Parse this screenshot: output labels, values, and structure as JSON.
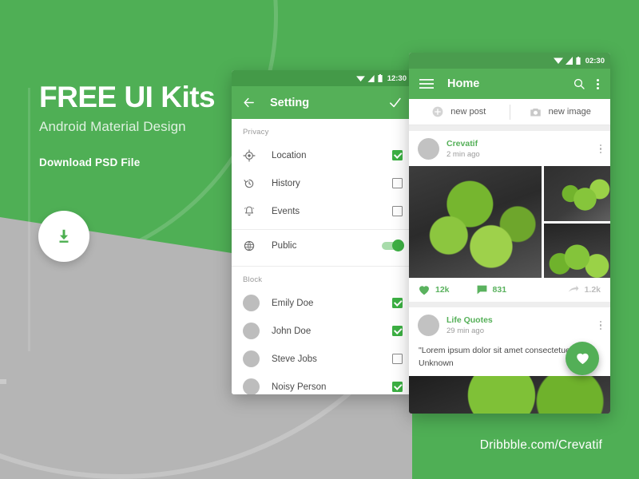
{
  "promo": {
    "title": "FREE UI Kits",
    "subtitle": "Android Material Design",
    "cta": "Download PSD File",
    "download_icon": "download-icon",
    "footer_url": "Dribbble.com/Crevatif",
    "accent_green": "#55b058",
    "background_gray": "#b5b5b5"
  },
  "settings_phone": {
    "status_bar": {
      "time": "12:30",
      "icons": [
        "wifi-icon",
        "signal-icon",
        "battery-icon"
      ]
    },
    "appbar": {
      "back_icon": "back-arrow-icon",
      "title": "Setting",
      "confirm_icon": "check-icon"
    },
    "sections": [
      {
        "label": "Privacy",
        "rows": [
          {
            "icon": "location-icon",
            "label": "Location",
            "control": "checkbox",
            "checked": true
          },
          {
            "icon": "history-icon",
            "label": "History",
            "control": "checkbox",
            "checked": false
          },
          {
            "icon": "bell-icon",
            "label": "Events",
            "control": "checkbox",
            "checked": false
          },
          {
            "icon": "globe-icon",
            "label": "Public",
            "control": "switch",
            "checked": true
          }
        ]
      },
      {
        "label": "Block",
        "rows": [
          {
            "icon": "avatar",
            "label": "Emily Doe",
            "control": "checkbox",
            "checked": true
          },
          {
            "icon": "avatar",
            "label": "John Doe",
            "control": "checkbox",
            "checked": true
          },
          {
            "icon": "avatar",
            "label": "Steve Jobs",
            "control": "checkbox",
            "checked": false
          },
          {
            "icon": "avatar",
            "label": "Noisy Person",
            "control": "checkbox",
            "checked": true
          }
        ]
      }
    ]
  },
  "home_phone": {
    "status_bar": {
      "time": "02:30",
      "icons": [
        "wifi-icon",
        "signal-icon",
        "battery-icon"
      ]
    },
    "appbar": {
      "menu_icon": "hamburger-menu-icon",
      "title": "Home",
      "search_icon": "search-icon",
      "overflow_icon": "overflow-menu-icon"
    },
    "quick_actions": [
      {
        "icon": "plus-circle-icon",
        "label": "new post"
      },
      {
        "icon": "camera-icon",
        "label": "new image"
      }
    ],
    "posts": [
      {
        "author": "Crevatif",
        "time": "2 min ago",
        "overflow_icon": "overflow-menu-icon",
        "media": [
          "apples-large",
          "apples-basket",
          "apples-close"
        ],
        "stats": {
          "likes": "12k",
          "likes_icon": "heart-icon",
          "comments": "831",
          "comments_icon": "comment-icon",
          "shares": "1.2k",
          "shares_icon": "share-icon"
        }
      },
      {
        "author": "Life Quotes",
        "time": "29 min ago",
        "overflow_icon": "overflow-menu-icon",
        "quote": "\"Lorem ipsum dolor sit amet consectetuer.\"",
        "quote_author": "Unknown"
      }
    ],
    "fab": {
      "icon": "heart-icon"
    }
  }
}
